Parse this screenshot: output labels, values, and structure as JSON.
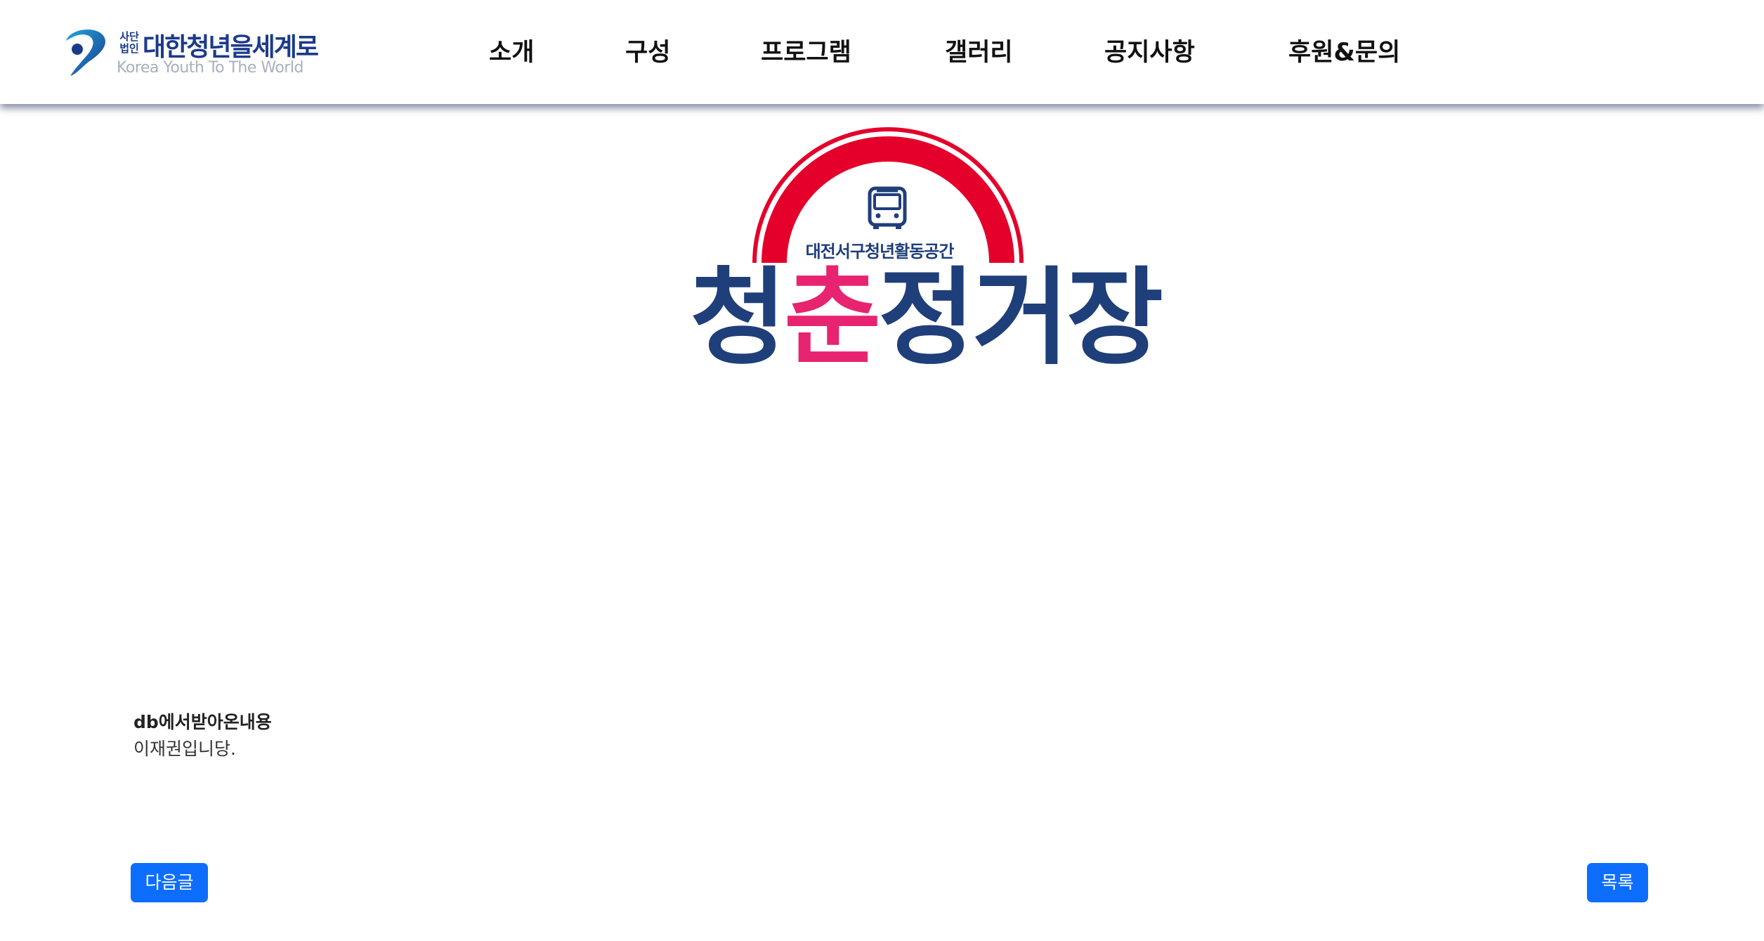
{
  "brand": {
    "corp_label": "사단법인",
    "name": "대한청년을세계로",
    "subtitle": "Korea Youth To The World"
  },
  "nav": [
    {
      "label": "소개"
    },
    {
      "label": "구성"
    },
    {
      "label": "프로그램"
    },
    {
      "label": "갤러리"
    },
    {
      "label": "공지사항"
    },
    {
      "label": "후원&문의"
    }
  ],
  "hero": {
    "caption": "대전서구청년활동공간",
    "title_pre": "청",
    "title_accent": "춘",
    "title_post": "정거장"
  },
  "post": {
    "title": "db에서받아온내용",
    "body": "이재권입니당."
  },
  "buttons": {
    "next": "다음글",
    "list": "목록"
  },
  "colors": {
    "brand_navy": "#1b3a8a",
    "accent_red": "#e4002b",
    "accent_pink": "#e8236f",
    "button_blue": "#0d6efd"
  }
}
